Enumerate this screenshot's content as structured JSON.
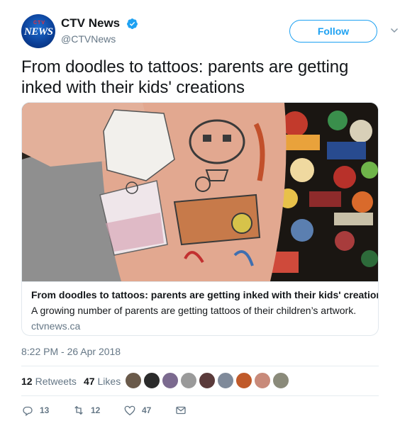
{
  "account": {
    "name": "CTV News",
    "handle": "@CTVNews",
    "avatar_logo_text": "NEWS",
    "avatar_logo_dots": "CTV",
    "verified": true
  },
  "follow_button": {
    "label": "Follow"
  },
  "tweet": {
    "text": "From doodles to tattoos: parents are getting inked with their kids' creations",
    "timestamp": "8:22 PM - 26 Apr 2018"
  },
  "card": {
    "title": "From doodles to tattoos: parents are getting inked with their kids' creations",
    "description": "A growing number of parents are getting tattoos of their children’s artwork.",
    "domain": "ctvnews.ca"
  },
  "stats": {
    "retweets_count": "12",
    "retweets_label": "Retweets",
    "likes_count": "47",
    "likes_label": "Likes"
  },
  "actions": {
    "reply_count": "13",
    "retweet_count": "12",
    "like_count": "47"
  },
  "colors": {
    "accent": "#1da1f2",
    "text": "#14171a",
    "secondary": "#657786",
    "border": "#e1e8ed"
  }
}
